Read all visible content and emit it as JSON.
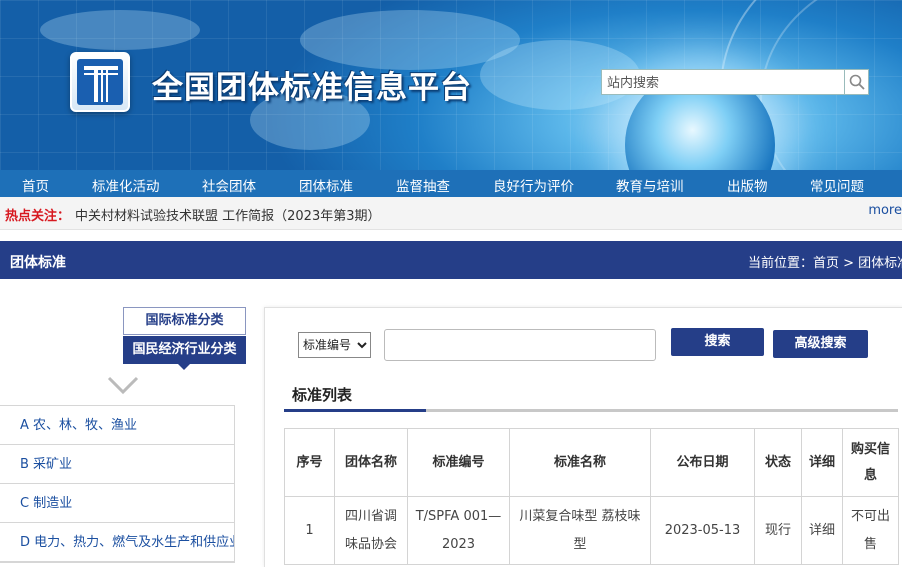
{
  "header": {
    "site_title": "全国团体标准信息平台",
    "search_placeholder": "站内搜索"
  },
  "nav": {
    "items": [
      "首页",
      "标准化活动",
      "社会团体",
      "团体标准",
      "监督抽查",
      "良好行为评价",
      "教育与培训",
      "出版物",
      "常见问题"
    ]
  },
  "hot": {
    "label": "热点关注：",
    "text": "中关村材料试验技术联盟 工作简报（2023年第3期）",
    "more": "more"
  },
  "section": {
    "title": "团体标准",
    "breadcrumb": "当前位置：首页 > 团体标准"
  },
  "sidebar": {
    "tab_international": "国际标准分类",
    "tab_national": "国民经济行业分类",
    "categories": [
      "A 农、林、牧、渔业",
      "B 采矿业",
      "C 制造业",
      "D 电力、热力、燃气及水生产和供应业"
    ]
  },
  "search": {
    "select_value": "标准编号",
    "keyword_value": "",
    "search_button": "搜索",
    "advanced_button": "高级搜索"
  },
  "list": {
    "title": "标准列表",
    "headers": [
      "序号",
      "团体名称",
      "标准编号",
      "标准名称",
      "公布日期",
      "状态",
      "详细",
      "购买信息"
    ],
    "rows": [
      {
        "index": "1",
        "org": "四川省调味品协会",
        "code": "T/SPFA 001—2023",
        "name": "川菜复合味型 荔枝味型",
        "date": "2023-05-13",
        "status": "现行",
        "detail": "详细",
        "purchase": "不可出售"
      }
    ]
  },
  "colors": {
    "nav_blue": "#1e70b8",
    "dark_navy": "#253e88",
    "link_blue": "#1b4fa0",
    "hot_red": "#d71920"
  }
}
